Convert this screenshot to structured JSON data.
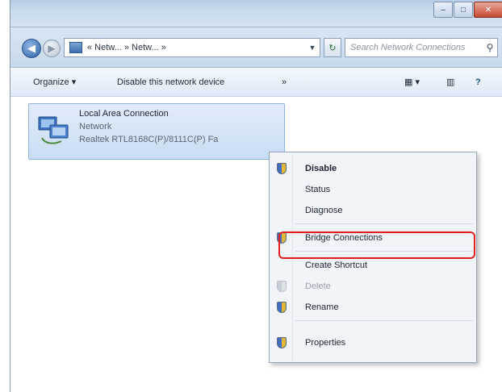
{
  "window": {
    "caption_buttons": {
      "minimize": "–",
      "maximize": "□",
      "close": "✕"
    }
  },
  "address_bar": {
    "back_glyph": "◀",
    "forward_glyph": "▶",
    "path": "« Netw... » Netw... »",
    "refresh_glyph": "↻",
    "search_placeholder": "Search Network Connections",
    "search_icon": "search-icon"
  },
  "command_bar": {
    "organize_label": "Organize ▾",
    "disable_label": "Disable this network device",
    "more_glyph": "»",
    "view_glyph": "▦ ▾",
    "preview_glyph": "▥",
    "help_glyph": "?"
  },
  "network_item": {
    "name": "Local Area Connection",
    "status": "Network",
    "device": "Realtek RTL8168C(P)/8111C(P) Fa"
  },
  "context_menu": {
    "items": [
      {
        "label": "Disable",
        "icon": "shield-icon",
        "state": "default"
      },
      {
        "label": "Status",
        "icon": "",
        "state": "normal"
      },
      {
        "label": "Diagnose",
        "icon": "",
        "state": "normal"
      },
      {
        "label": "Bridge Connections",
        "icon": "shield-icon",
        "state": "normal"
      },
      {
        "label": "Create Shortcut",
        "icon": "",
        "state": "normal"
      },
      {
        "label": "Delete",
        "icon": "shield-icon",
        "state": "disabled"
      },
      {
        "label": "Rename",
        "icon": "shield-icon",
        "state": "normal"
      },
      {
        "label": "Properties",
        "icon": "shield-icon",
        "state": "normal"
      }
    ]
  },
  "colors": {
    "highlight": "#e0221b",
    "selection": "#c9dcf5"
  }
}
